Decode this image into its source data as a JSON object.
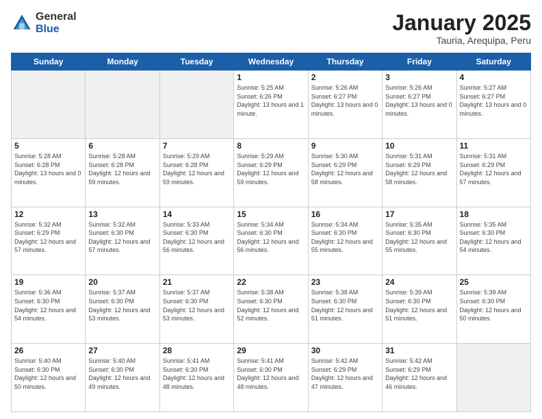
{
  "header": {
    "logo_general": "General",
    "logo_blue": "Blue",
    "month_title": "January 2025",
    "subtitle": "Tauria, Arequipa, Peru"
  },
  "weekdays": [
    "Sunday",
    "Monday",
    "Tuesday",
    "Wednesday",
    "Thursday",
    "Friday",
    "Saturday"
  ],
  "weeks": [
    [
      {
        "day": "",
        "empty": true
      },
      {
        "day": "",
        "empty": true
      },
      {
        "day": "",
        "empty": true
      },
      {
        "day": "1",
        "sunrise": "5:25 AM",
        "sunset": "6:26 PM",
        "daylight": "13 hours and 1 minute."
      },
      {
        "day": "2",
        "sunrise": "5:26 AM",
        "sunset": "6:27 PM",
        "daylight": "13 hours and 0 minutes."
      },
      {
        "day": "3",
        "sunrise": "5:26 AM",
        "sunset": "6:27 PM",
        "daylight": "13 hours and 0 minutes."
      },
      {
        "day": "4",
        "sunrise": "5:27 AM",
        "sunset": "6:27 PM",
        "daylight": "13 hours and 0 minutes."
      }
    ],
    [
      {
        "day": "5",
        "sunrise": "5:28 AM",
        "sunset": "6:28 PM",
        "daylight": "13 hours and 0 minutes."
      },
      {
        "day": "6",
        "sunrise": "5:28 AM",
        "sunset": "6:28 PM",
        "daylight": "12 hours and 59 minutes."
      },
      {
        "day": "7",
        "sunrise": "5:29 AM",
        "sunset": "6:28 PM",
        "daylight": "12 hours and 59 minutes."
      },
      {
        "day": "8",
        "sunrise": "5:29 AM",
        "sunset": "6:29 PM",
        "daylight": "12 hours and 59 minutes."
      },
      {
        "day": "9",
        "sunrise": "5:30 AM",
        "sunset": "6:29 PM",
        "daylight": "12 hours and 58 minutes."
      },
      {
        "day": "10",
        "sunrise": "5:31 AM",
        "sunset": "6:29 PM",
        "daylight": "12 hours and 58 minutes."
      },
      {
        "day": "11",
        "sunrise": "5:31 AM",
        "sunset": "6:29 PM",
        "daylight": "12 hours and 57 minutes."
      }
    ],
    [
      {
        "day": "12",
        "sunrise": "5:32 AM",
        "sunset": "6:29 PM",
        "daylight": "12 hours and 57 minutes."
      },
      {
        "day": "13",
        "sunrise": "5:32 AM",
        "sunset": "6:30 PM",
        "daylight": "12 hours and 57 minutes."
      },
      {
        "day": "14",
        "sunrise": "5:33 AM",
        "sunset": "6:30 PM",
        "daylight": "12 hours and 56 minutes."
      },
      {
        "day": "15",
        "sunrise": "5:34 AM",
        "sunset": "6:30 PM",
        "daylight": "12 hours and 56 minutes."
      },
      {
        "day": "16",
        "sunrise": "5:34 AM",
        "sunset": "6:30 PM",
        "daylight": "12 hours and 55 minutes."
      },
      {
        "day": "17",
        "sunrise": "5:35 AM",
        "sunset": "6:30 PM",
        "daylight": "12 hours and 55 minutes."
      },
      {
        "day": "18",
        "sunrise": "5:35 AM",
        "sunset": "6:30 PM",
        "daylight": "12 hours and 54 minutes."
      }
    ],
    [
      {
        "day": "19",
        "sunrise": "5:36 AM",
        "sunset": "6:30 PM",
        "daylight": "12 hours and 54 minutes."
      },
      {
        "day": "20",
        "sunrise": "5:37 AM",
        "sunset": "6:30 PM",
        "daylight": "12 hours and 53 minutes."
      },
      {
        "day": "21",
        "sunrise": "5:37 AM",
        "sunset": "6:30 PM",
        "daylight": "12 hours and 53 minutes."
      },
      {
        "day": "22",
        "sunrise": "5:38 AM",
        "sunset": "6:30 PM",
        "daylight": "12 hours and 52 minutes."
      },
      {
        "day": "23",
        "sunrise": "5:38 AM",
        "sunset": "6:30 PM",
        "daylight": "12 hours and 51 minutes."
      },
      {
        "day": "24",
        "sunrise": "5:39 AM",
        "sunset": "6:30 PM",
        "daylight": "12 hours and 51 minutes."
      },
      {
        "day": "25",
        "sunrise": "5:39 AM",
        "sunset": "6:30 PM",
        "daylight": "12 hours and 50 minutes."
      }
    ],
    [
      {
        "day": "26",
        "sunrise": "5:40 AM",
        "sunset": "6:30 PM",
        "daylight": "12 hours and 50 minutes."
      },
      {
        "day": "27",
        "sunrise": "5:40 AM",
        "sunset": "6:30 PM",
        "daylight": "12 hours and 49 minutes."
      },
      {
        "day": "28",
        "sunrise": "5:41 AM",
        "sunset": "6:30 PM",
        "daylight": "12 hours and 48 minutes."
      },
      {
        "day": "29",
        "sunrise": "5:41 AM",
        "sunset": "6:30 PM",
        "daylight": "12 hours and 48 minutes."
      },
      {
        "day": "30",
        "sunrise": "5:42 AM",
        "sunset": "6:29 PM",
        "daylight": "12 hours and 47 minutes."
      },
      {
        "day": "31",
        "sunrise": "5:42 AM",
        "sunset": "6:29 PM",
        "daylight": "12 hours and 46 minutes."
      },
      {
        "day": "",
        "empty": true
      }
    ]
  ]
}
